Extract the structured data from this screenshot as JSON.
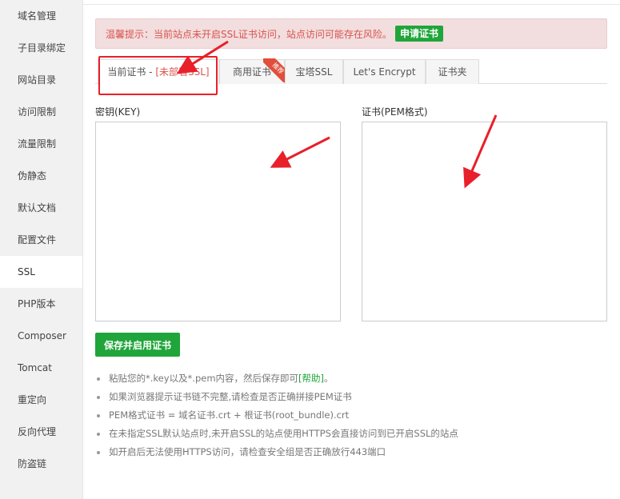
{
  "sidebar": {
    "items": [
      {
        "label": "域名管理"
      },
      {
        "label": "子目录绑定"
      },
      {
        "label": "网站目录"
      },
      {
        "label": "访问限制"
      },
      {
        "label": "流量限制"
      },
      {
        "label": "伪静态"
      },
      {
        "label": "默认文档"
      },
      {
        "label": "配置文件"
      },
      {
        "label": "SSL"
      },
      {
        "label": "PHP版本"
      },
      {
        "label": "Composer"
      },
      {
        "label": "Tomcat"
      },
      {
        "label": "重定向"
      },
      {
        "label": "反向代理"
      },
      {
        "label": "防盗链"
      }
    ],
    "active_index": 8
  },
  "alert": {
    "text": "温馨提示：当前站点未开启SSL证书访问，站点访问可能存在风险。",
    "apply_button": "申请证书"
  },
  "tabs": {
    "current_prefix": "当前证书 - ",
    "current_status": "[未部署SSL]",
    "commercial": "商用证书",
    "commercial_badge": "推荐",
    "baota": "宝塔SSL",
    "letsencrypt": "Let's Encrypt",
    "cert_folder": "证书夹"
  },
  "form": {
    "key_label": "密钥(KEY)",
    "key_value": "",
    "cert_label": "证书(PEM格式)",
    "cert_value": "",
    "save_button": "保存并启用证书"
  },
  "tips": {
    "tip1_before": "粘贴您的*.key以及*.pem内容，然后保存即可",
    "tip1_link": "[帮助]",
    "tip1_after": "。",
    "tip2": "如果浏览器提示证书链不完整,请检查是否正确拼接PEM证书",
    "tip3": "PEM格式证书 = 域名证书.crt + 根证书(root_bundle).crt",
    "tip4": "在未指定SSL默认站点时,未开启SSL的站点使用HTTPS会直接访问到已开启SSL的站点",
    "tip5": "如开启后无法使用HTTPS访问，请检查安全组是否正确放行443端口"
  },
  "colors": {
    "accent": "#20a53a",
    "alert_text": "#d9534f",
    "alert_bg": "#f2dede",
    "annotation": "#e8202a"
  }
}
